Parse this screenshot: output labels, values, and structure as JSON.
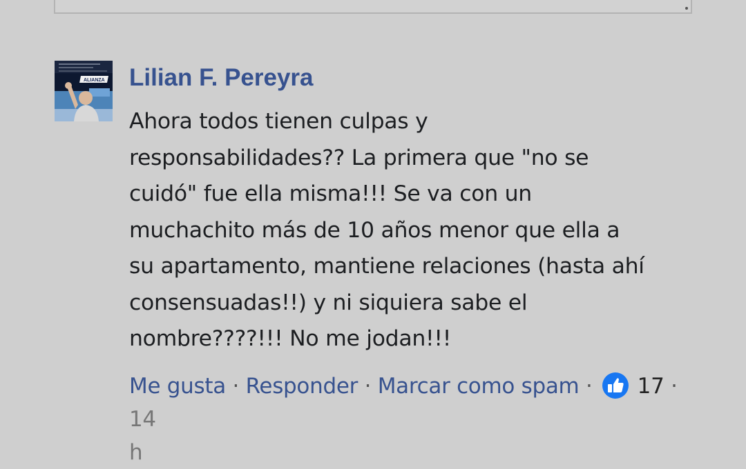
{
  "comment": {
    "author": "Lilian F. Pereyra",
    "avatar_badge_text": "ALIANZA",
    "text_lines": [
      "Ahora todos tienen culpas y",
      "responsabilidades?? La primera que \"no se",
      "cuidó\" fue ella misma!!! Se va con un",
      "muchachito más de 10 años menor que ella a",
      "su apartamento, mantiene relaciones (hasta ahí",
      "consensuadas!!) y ni siquiera sabe el",
      "nombre????!!! No me jodan!!!"
    ],
    "actions": {
      "like_label": "Me gusta",
      "reply_label": "Responder",
      "spam_label": "Marcar como spam",
      "separator": " · ",
      "like_icon": "thumbs-up-icon",
      "like_count": "17",
      "timestamp_part1": "14",
      "timestamp_part2": "h"
    }
  },
  "colors": {
    "background": "#cfcfcf",
    "link": "#37528f",
    "like_badge": "#1877f2",
    "text": "#1c1e21"
  }
}
